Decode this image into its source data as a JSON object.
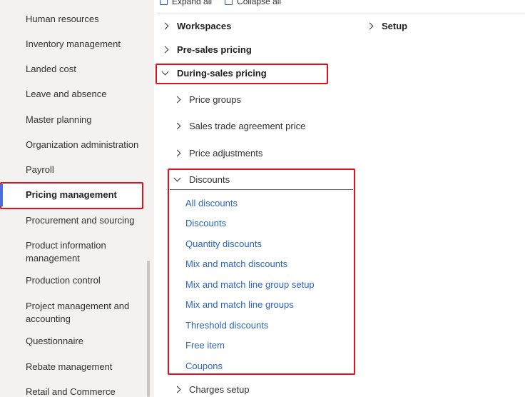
{
  "sidebar": {
    "items": [
      {
        "label": "Human resources"
      },
      {
        "label": "Inventory management"
      },
      {
        "label": "Landed cost"
      },
      {
        "label": "Leave and absence"
      },
      {
        "label": "Master planning"
      },
      {
        "label": "Organization administration"
      },
      {
        "label": "Payroll"
      },
      {
        "label": "Pricing management",
        "selected": true
      },
      {
        "label": "Procurement and sourcing"
      },
      {
        "label": "Product information management"
      },
      {
        "label": "Production control"
      },
      {
        "label": "Project management and accounting"
      },
      {
        "label": "Questionnaire"
      },
      {
        "label": "Rebate management"
      },
      {
        "label": "Retail and Commerce"
      }
    ]
  },
  "toolbar": {
    "expand_all": "Expand all",
    "collapse_all": "Collapse all"
  },
  "tree": {
    "workspaces": "Workspaces",
    "setup": "Setup",
    "pre_sales": "Pre-sales pricing",
    "during_sales": "During-sales pricing",
    "price_groups": "Price groups",
    "sales_trade_agreement": "Sales trade agreement price",
    "price_adjustments": "Price adjustments",
    "discounts_group": "Discounts",
    "discount_links": [
      "All discounts",
      "Discounts",
      "Quantity discounts",
      "Mix and match discounts",
      "Mix and match line group setup",
      "Mix and match line groups",
      "Threshold discounts",
      "Free item",
      "Coupons"
    ],
    "charges_setup": "Charges setup"
  },
  "colors": {
    "highlight": "#e3101e",
    "link": "#2b64c4",
    "accent": "#4a6edb"
  }
}
